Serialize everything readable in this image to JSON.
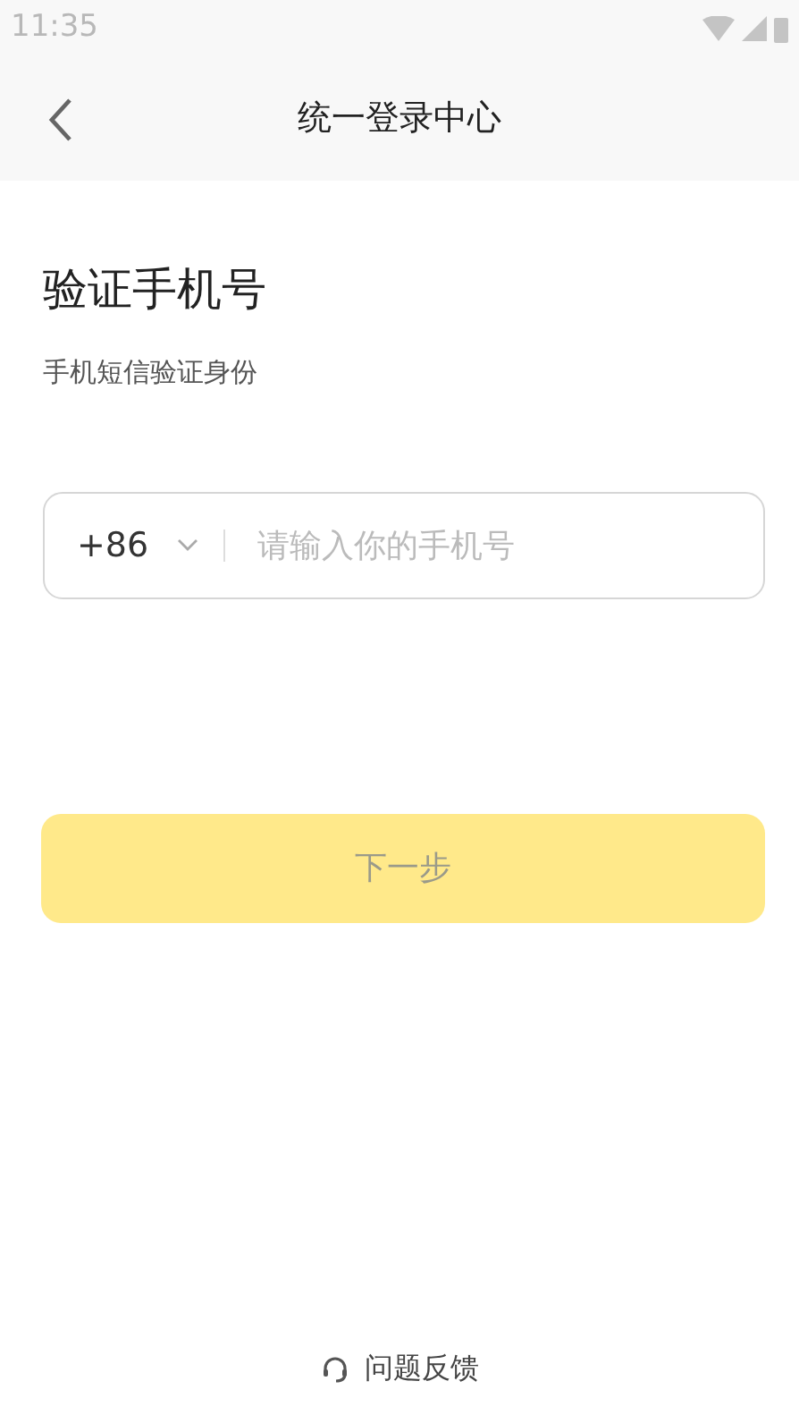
{
  "status_bar": {
    "time": "11:35"
  },
  "header": {
    "title": "统一登录中心"
  },
  "heading": "验证手机号",
  "subtitle": "手机短信验证身份",
  "phone_field": {
    "country_code": "+86",
    "placeholder": "请输入你的手机号"
  },
  "next_button": {
    "label": "下一步",
    "disabled": true
  },
  "footer": {
    "label": "问题反馈"
  }
}
